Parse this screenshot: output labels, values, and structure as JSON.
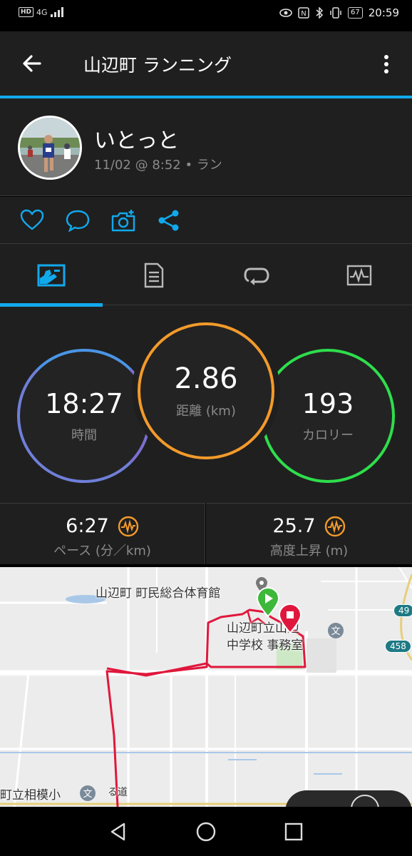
{
  "status_bar": {
    "network_badge": "HD",
    "network_type": "4G",
    "battery": "67",
    "time": "20:59"
  },
  "app_bar": {
    "title": "山辺町 ランニング",
    "back_icon": "arrow-left-icon",
    "menu_icon": "more-vertical-icon"
  },
  "profile": {
    "name": "いとっと",
    "meta": "11/02 @ 8:52 • ラン"
  },
  "actions": {
    "icons": [
      "heart-icon",
      "comment-icon",
      "add-photo-icon",
      "share-icon"
    ]
  },
  "tabs": {
    "items": [
      "stats-icon",
      "details-icon",
      "laps-icon",
      "chart-icon"
    ],
    "active_index": 0
  },
  "stats": {
    "time": {
      "value": "18:27",
      "label": "時間"
    },
    "distance": {
      "value": "2.86",
      "label": "距離 (km)"
    },
    "calories": {
      "value": "193",
      "label": "カロリー"
    }
  },
  "secondary": {
    "pace": {
      "value": "6:27",
      "label": "ペース (分／km)"
    },
    "elevation": {
      "value": "25.7",
      "label": "高度上昇 (m)"
    }
  },
  "map": {
    "labels": {
      "gym": "山辺町 町民総合体育館",
      "school_line1": "山辺町立山辺",
      "school_line2": "中学校 事務室",
      "school_bottom": "町立相模小",
      "road_text": "る道"
    },
    "route_badges": [
      "49",
      "458"
    ],
    "colors": {
      "route": "#e0173c",
      "start": "#3db83a",
      "end": "#e0173c"
    }
  },
  "colors": {
    "accent": "#11a9ed",
    "time_ring": "#6f7fd8",
    "distance_ring": "#f39a2b",
    "calorie_ring": "#2ede4c",
    "metric_icon": "#f39a2b"
  }
}
